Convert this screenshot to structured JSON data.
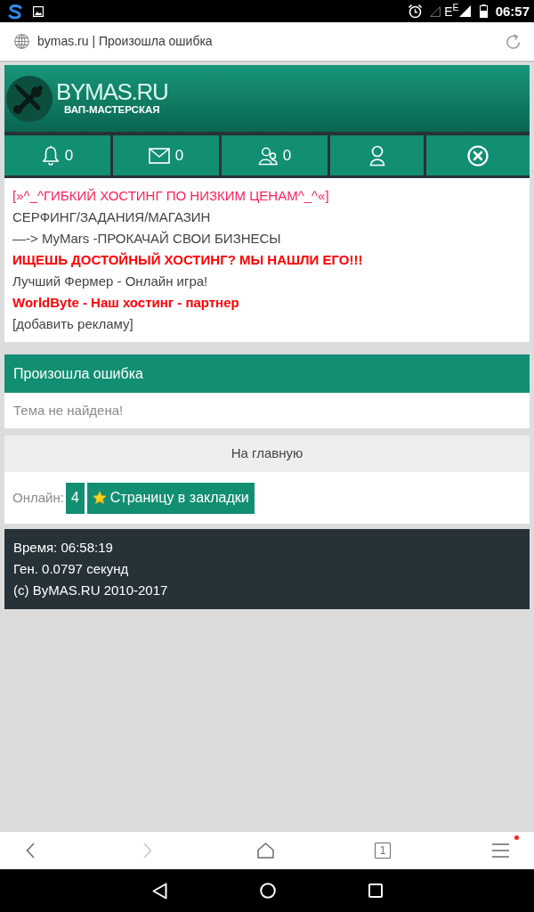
{
  "status_bar": {
    "network": "E$^{E}$",
    "time": "06:57"
  },
  "address_bar": {
    "title": "bymas.ru | Произошла ошибка"
  },
  "header": {
    "logo_title": "BYMAS.RU",
    "logo_subtitle": "ВАП-МАСТЕРСКАЯ"
  },
  "nav_buttons": [
    {
      "kind": "notifications",
      "count": "0"
    },
    {
      "kind": "messages",
      "count": "0"
    },
    {
      "kind": "friends",
      "count": "0"
    },
    {
      "kind": "profile"
    },
    {
      "kind": "logout"
    }
  ],
  "ads": [
    {
      "text": "[»^_^ГИБКИЙ ХОСТИНГ ПО НИЗКИМ ЦЕНАМ^_^«]",
      "color": "#ff1f57",
      "bold": false
    },
    {
      "text": "СЕРФИНГ/ЗАДАНИЯ/МАГАЗИН",
      "color": "#444444",
      "bold": false
    },
    {
      "text": "—-> MyMars -ПРОКАЧАЙ СВОИ БИЗНЕСЫ",
      "color": "#444444",
      "bold": false
    },
    {
      "text": "ИЩЕШЬ ДОСТОЙНЫЙ ХОСТИНГ? МЫ НАШЛИ ЕГО!!!",
      "color": "#ff0000",
      "bold": true
    },
    {
      "text": "Лучший Фермер - Онлайн игра!",
      "color": "#444444",
      "bold": false
    },
    {
      "text": "WorldByte - Наш хостинг - партнер",
      "color": "#ff0000",
      "bold": true
    },
    {
      "text": "[добавить рекламу]",
      "color": "#444444",
      "bold": false
    }
  ],
  "error": {
    "title": "Произошла ошибка",
    "message": "Тема не найдена!"
  },
  "home_link": "На главную",
  "online": {
    "label": "Онлайн:",
    "count": "4",
    "bookmark_button": "Страницу в закладки"
  },
  "footer": [
    "Время: 06:58:19",
    "Ген. 0.0797 секунд",
    "(c) ByMAS.RU 2010-2017"
  ],
  "toolbar": [
    {
      "kind": "back",
      "disabled": false,
      "dot": false
    },
    {
      "kind": "forward",
      "disabled": true,
      "dot": false
    },
    {
      "kind": "home",
      "disabled": false,
      "dot": false
    },
    {
      "kind": "tabs",
      "label": "1",
      "disabled": false,
      "dot": false
    },
    {
      "kind": "menu",
      "disabled": false,
      "dot": true
    }
  ]
}
